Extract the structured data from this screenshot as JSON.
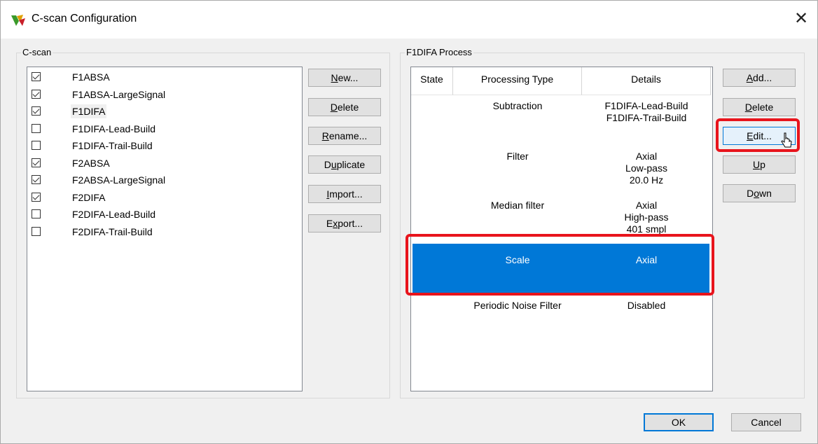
{
  "window": {
    "title": "C-scan Configuration",
    "close_symbol": "✕"
  },
  "cscan": {
    "group_label": "C-scan",
    "items": [
      {
        "label": "F1ABSA",
        "checked": true
      },
      {
        "label": "F1ABSA-LargeSignal",
        "checked": true
      },
      {
        "label": "F1DIFA",
        "checked": true,
        "selected": true
      },
      {
        "label": "F1DIFA-Lead-Build",
        "checked": false
      },
      {
        "label": "F1DIFA-Trail-Build",
        "checked": false
      },
      {
        "label": "F2ABSA",
        "checked": true
      },
      {
        "label": "F2ABSA-LargeSignal",
        "checked": true
      },
      {
        "label": "F2DIFA",
        "checked": true
      },
      {
        "label": "F2DIFA-Lead-Build",
        "checked": false
      },
      {
        "label": "F2DIFA-Trail-Build",
        "checked": false
      }
    ],
    "buttons": {
      "new": {
        "u": "N",
        "rest": "ew..."
      },
      "delete": {
        "u": "D",
        "rest": "elete"
      },
      "rename": {
        "u": "R",
        "rest": "ename..."
      },
      "duplicate": {
        "pre": "D",
        "u": "u",
        "rest": "plicate"
      },
      "import": {
        "u": "I",
        "rest": "mport..."
      },
      "export": {
        "pre": "E",
        "u": "x",
        "rest": "port..."
      }
    }
  },
  "process": {
    "group_label": "F1DIFA Process",
    "columns": {
      "state": "State",
      "type": "Processing Type",
      "details": "Details"
    },
    "rows": [
      {
        "type": "Subtraction",
        "details": [
          "F1DIFA-Lead-Build",
          "F1DIFA-Trail-Build"
        ]
      },
      {
        "type": "Filter",
        "details": [
          "Axial",
          "Low-pass",
          "20.0 Hz"
        ]
      },
      {
        "type": "Median filter",
        "details": [
          "Axial",
          "High-pass",
          "401 smpl"
        ]
      },
      {
        "type": "Scale",
        "details": [
          "Axial"
        ],
        "selected": true
      },
      {
        "type": "Periodic Noise Filter",
        "details": [
          "Disabled"
        ]
      }
    ],
    "buttons": {
      "add": {
        "u": "A",
        "rest": "dd..."
      },
      "delete": {
        "u": "D",
        "rest": "elete"
      },
      "edit": {
        "u": "E",
        "rest": "dit..."
      },
      "up": {
        "u": "U",
        "rest": "p"
      },
      "down": {
        "pre": "D",
        "u": "o",
        "rest": "wn"
      }
    }
  },
  "footer": {
    "ok": "OK",
    "cancel": "Cancel"
  },
  "colors": {
    "selection": "#0078d7",
    "highlight": "#e8141c"
  }
}
